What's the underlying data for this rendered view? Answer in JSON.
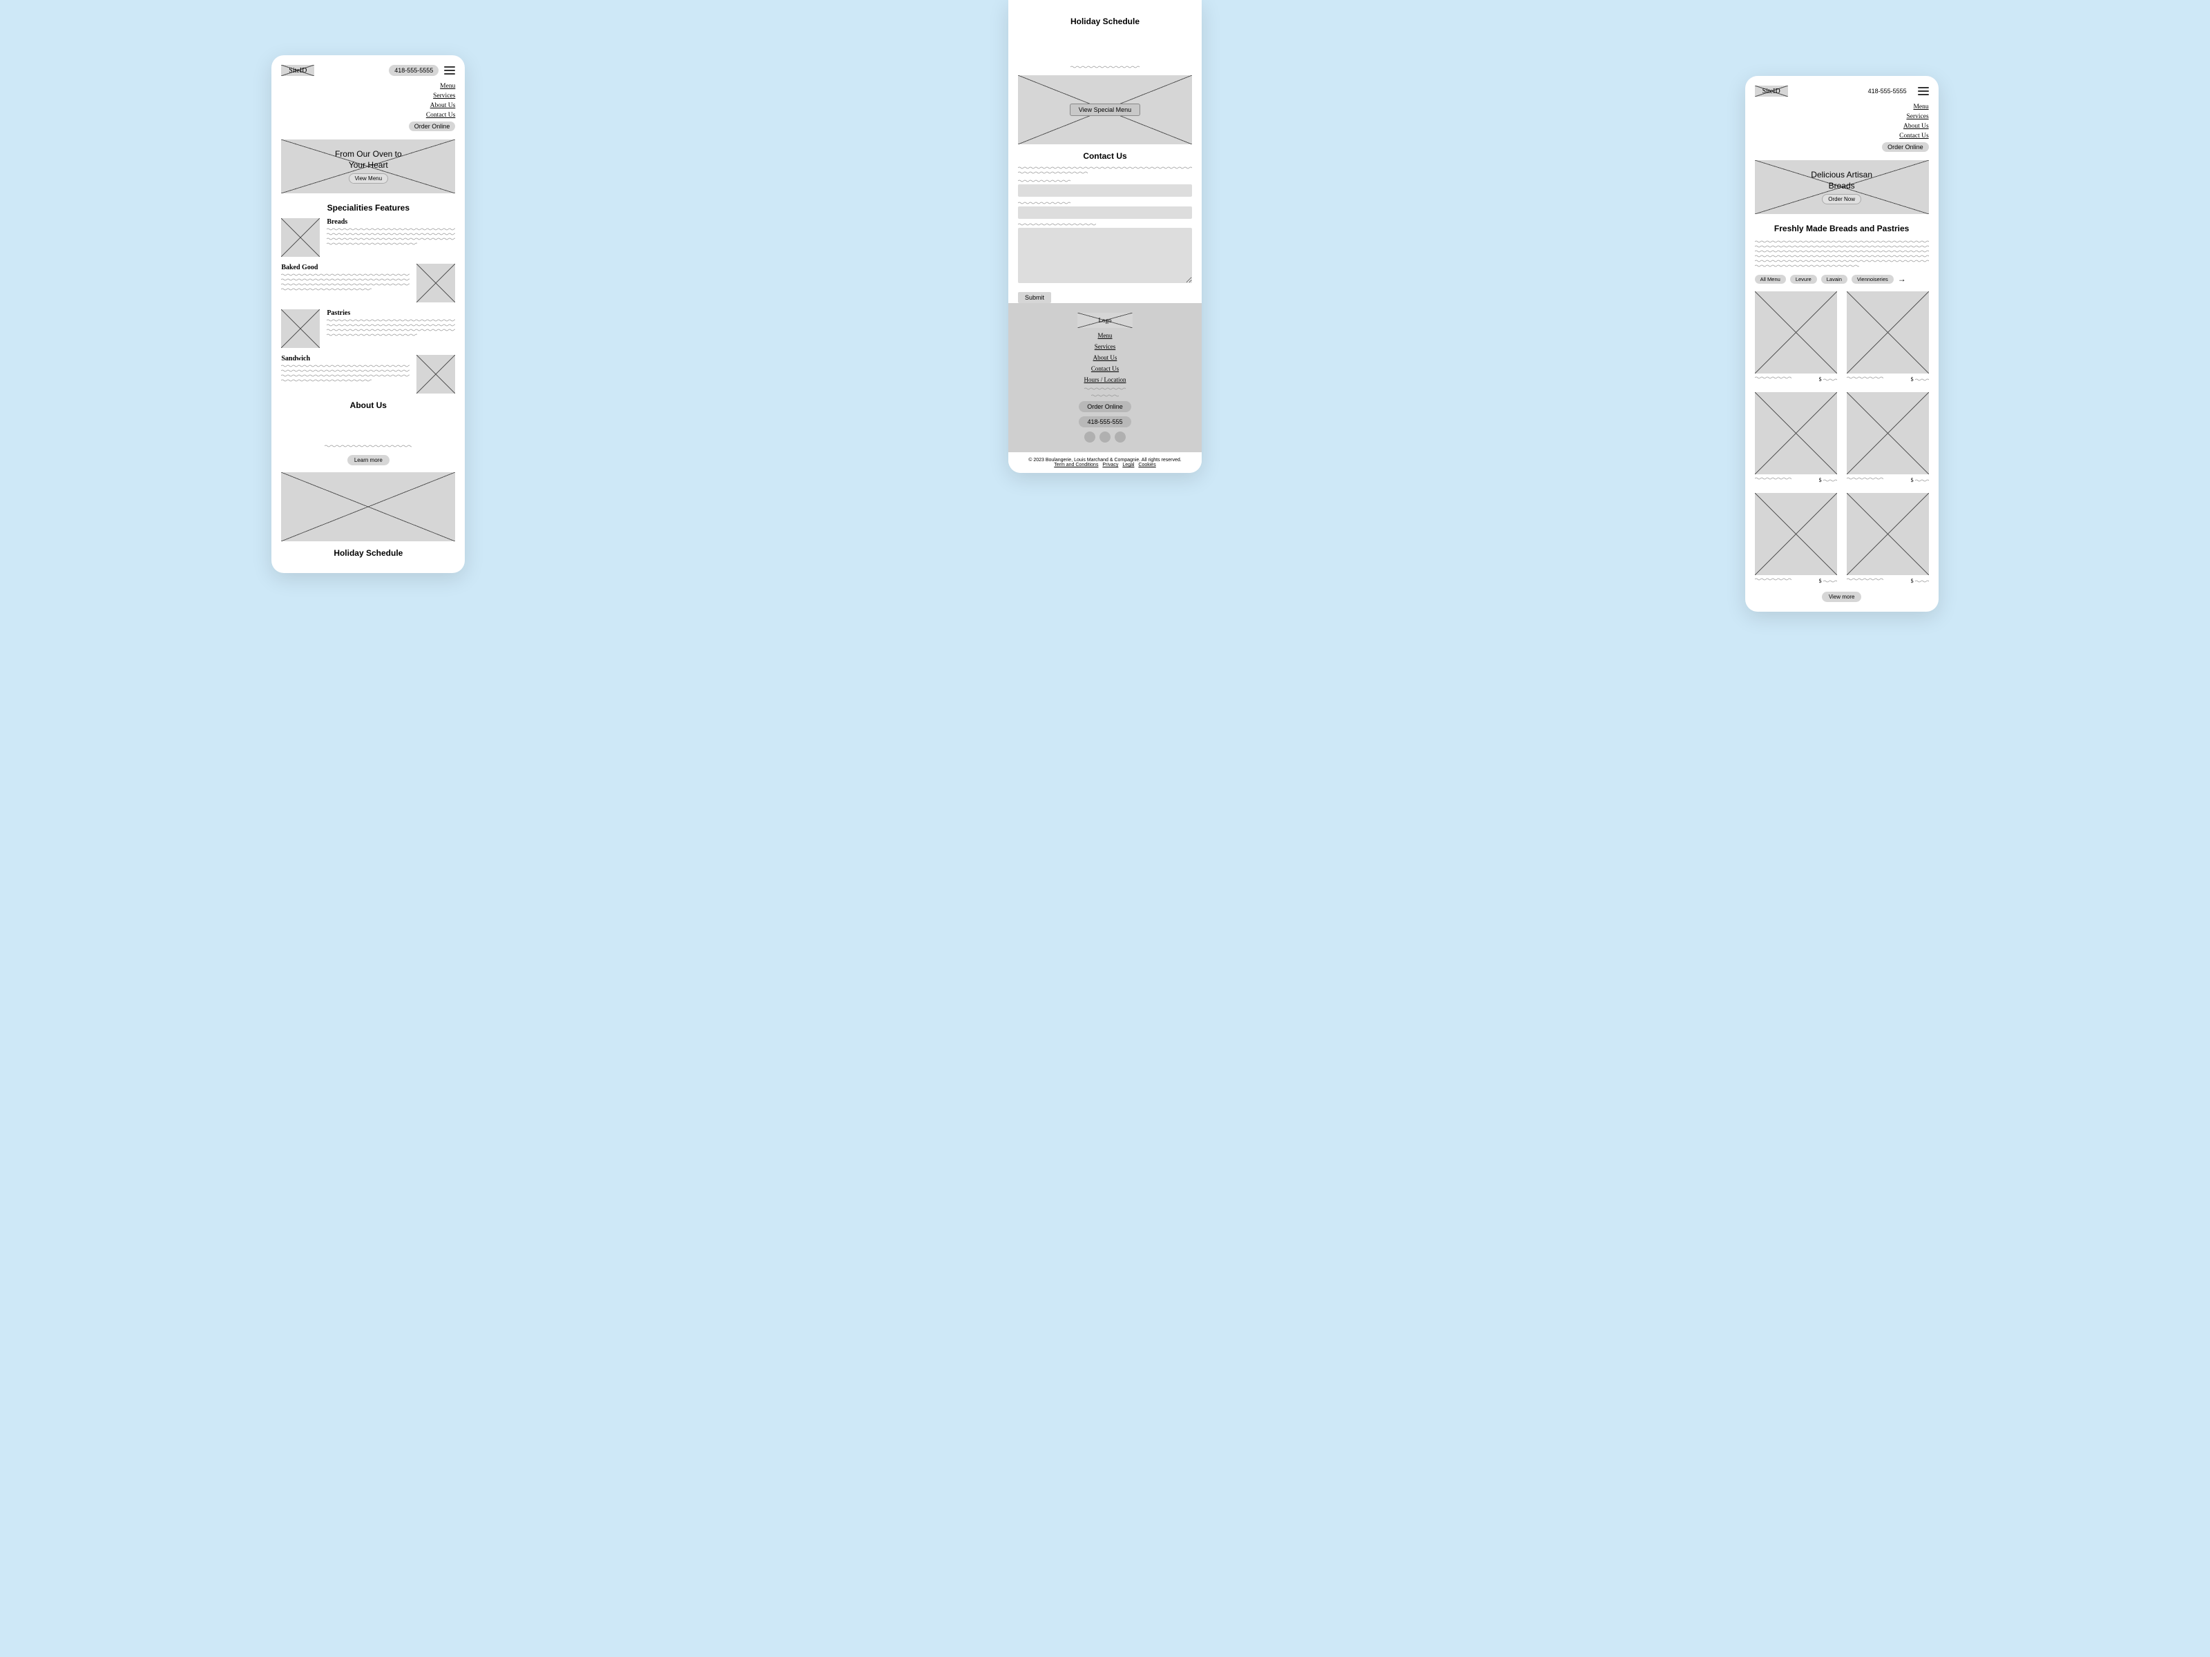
{
  "common": {
    "site_id_label": "SiteID",
    "phone_number": "418-555-5555",
    "nav": {
      "menu": "Menu",
      "services": "Services",
      "about": "About Us",
      "contact": "Contact Us",
      "order": "Order Online"
    }
  },
  "screen1": {
    "hero_title": "From Our Oven to\nYour Heart",
    "hero_button": "View Menu",
    "specialities_heading": "Specialities Features",
    "items": [
      {
        "title": "Breads"
      },
      {
        "title": "Baked Good"
      },
      {
        "title": "Pastries"
      },
      {
        "title": "Sandwich"
      }
    ],
    "about_heading": "About Us",
    "learn_more": "Learn more",
    "holiday_heading": "Holiday Schedule"
  },
  "screen2": {
    "holiday_heading": "Holiday Schedule",
    "special_button": "View Special Menu",
    "contact_heading": "Contact Us",
    "submit": "Submit",
    "footer": {
      "logo_label": "Logo",
      "menu": "Menu",
      "services": "Services",
      "about": "About Us",
      "contact": "Contact Us",
      "hours": "Hours / Location",
      "order": "Order Online",
      "phone": "418-555-555"
    },
    "legal": {
      "copyright": "© 2023 Boulangerie, Louis Marchand & Compagnie. All rights reserved.",
      "terms": "Term and Conditions",
      "privacy": "Privacy",
      "legal": "Legal",
      "cookies": "Cookies"
    }
  },
  "screen3": {
    "hero_title": "Delicious Artisan\nBreads",
    "hero_button": "Order Now",
    "subhead": "Freshly Made Breads and Pastries",
    "chips": {
      "all": "All Menu",
      "levure": "Levure",
      "lavain": "Lavain",
      "vienn": "Viennoiseries"
    },
    "price_symbol": "$",
    "view_more": "View more"
  }
}
